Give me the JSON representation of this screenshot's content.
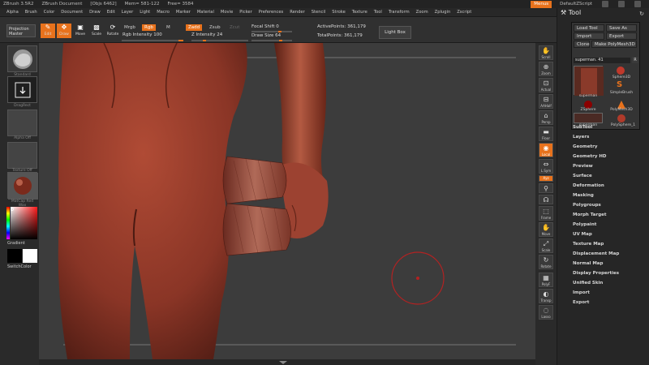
{
  "titlebar": {
    "app": "ZBrush 3.5R2",
    "document": "ZBrush Document",
    "objs": "[Objs 6462]",
    "mem": "Mem= 581-122",
    "free": "Free= 3584",
    "menus": "Menus",
    "script": "DefaultZScript"
  },
  "menubar": [
    "Alpha",
    "Brush",
    "Color",
    "Document",
    "Draw",
    "Edit",
    "Layer",
    "Light",
    "Macro",
    "Marker",
    "Material",
    "Movie",
    "Picker",
    "Preferences",
    "Render",
    "Stencil",
    "Stroke",
    "Texture",
    "Tool",
    "Transform",
    "Zoom",
    "Zplugin",
    "Zscript"
  ],
  "shelf": {
    "projection": "Projection Master",
    "edit": "Edit",
    "draw": "Draw",
    "move": "Move",
    "scale": "Scale",
    "rotate": "Rotate",
    "mrgb": "Mrgb",
    "rgb": "Rgb",
    "m": "M",
    "zadd": "Zadd",
    "zsub": "Zsub",
    "zcut": "Zcut",
    "rgb_intensity_label": "Rgb Intensity",
    "rgb_intensity": "100",
    "z_intensity_label": "Z Intensity",
    "z_intensity": "24",
    "focal_shift_label": "Focal Shift",
    "focal_shift": "0",
    "draw_size_label": "Draw Size",
    "draw_size": "64",
    "active_points": "ActivePoints: 361,179",
    "total_points": "TotalPoints: 361,179",
    "light_box": "Light Box"
  },
  "leftpanel": {
    "brush_label": "Standard",
    "stroke_label": "DragRect",
    "alpha_label": "Alpha Off",
    "texture_label": "Texture Off",
    "material_label": "MatCap Red Wax",
    "gradient": "Gradient",
    "switch": "SwitchColor"
  },
  "rightstrip": [
    "Scroll",
    "Zoom",
    "Actual",
    "AAHalf",
    "Persp",
    "Floor",
    "Local",
    "L.Sym",
    "Xyz",
    "",
    "",
    "Frame",
    "Move",
    "Scale",
    "Rotate",
    "",
    "PolyF",
    "Transp",
    "",
    "Lasso"
  ],
  "toolpanel": {
    "title": "Tool",
    "load_tool": "Load Tool",
    "save_as": "Save As",
    "import": "Import",
    "export": "Export",
    "clone": "Clone",
    "make_polymesh": "Make PolyMesh3D",
    "tool_name": "superman. 41",
    "r_label": "R",
    "items": [
      {
        "label": "superman"
      },
      {
        "label": "Sphere3D"
      },
      {
        "label": "SimpleBrush"
      },
      {
        "label": "ZSphere"
      },
      {
        "label": "PolyMesh3D"
      },
      {
        "label": "superman"
      },
      {
        "label": "PolySphere_1"
      }
    ],
    "subpalettes": [
      "SubTool",
      "Layers",
      "Geometry",
      "Geometry HD",
      "Preview",
      "Surface",
      "Deformation",
      "Masking",
      "Polygroups",
      "Morph Target",
      "Polypaint",
      "UV Map",
      "Texture Map",
      "Displacement Map",
      "Normal Map",
      "Display Properties",
      "Unified Skin",
      "Import",
      "Export"
    ]
  },
  "colors": {
    "accent": "#e8721c",
    "skin": "#8c3a2a",
    "cursor_ring": "#b22222"
  }
}
